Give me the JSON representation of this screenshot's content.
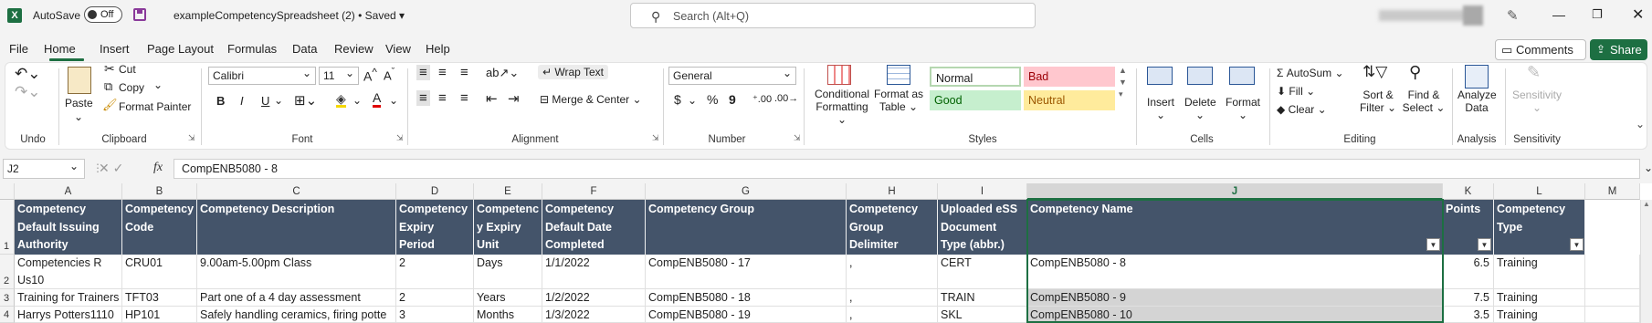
{
  "titlebar": {
    "app_logo": "X",
    "autosave_label": "AutoSave",
    "autosave_state": "Off",
    "doc_title": "exampleCompetencySpreadsheet (2) • Saved",
    "search_placeholder": "Search (Alt+Q)",
    "icons": [
      "excel-logo-icon",
      "save-icon",
      "search-icon",
      "pen-icon",
      "minimize-icon",
      "maximize-icon",
      "close-icon"
    ]
  },
  "menu": {
    "items": [
      "File",
      "Home",
      "Insert",
      "Page Layout",
      "Formulas",
      "Data",
      "Review",
      "View",
      "Help"
    ],
    "active": "Home",
    "comments": "Comments",
    "share": "Share"
  },
  "ribbon": {
    "undo": {
      "label": "Undo"
    },
    "clipboard": {
      "paste": "Paste",
      "cut": "Cut",
      "copy": "Copy",
      "format_painter": "Format Painter",
      "label": "Clipboard"
    },
    "font": {
      "name": "Calibri",
      "size": "11",
      "bold": "B",
      "italic": "I",
      "underline": "U",
      "label": "Font"
    },
    "alignment": {
      "wrap_text": "Wrap Text",
      "merge_center": "Merge & Center",
      "label": "Alignment"
    },
    "number": {
      "format": "General",
      "currency": "$",
      "percent": "%",
      "comma": "9",
      "label": "Number"
    },
    "styles": {
      "conditional_formatting": "Conditional Formatting",
      "format_as_table": "Format as Table",
      "normal": "Normal",
      "bad": "Bad",
      "good": "Good",
      "neutral": "Neutral",
      "label": "Styles"
    },
    "cells": {
      "insert": "Insert",
      "delete": "Delete",
      "format": "Format",
      "label": "Cells"
    },
    "editing": {
      "autosum": "AutoSum",
      "fill": "Fill",
      "clear": "Clear",
      "sort_filter": "Sort & Filter",
      "find_select": "Find & Select",
      "label": "Editing"
    },
    "analysis": {
      "analyze_data": "Analyze Data",
      "label": "Analysis"
    },
    "sensitivity": {
      "sensitivity": "Sensitivity",
      "label": "Sensitivity"
    }
  },
  "formula_bar": {
    "name_box": "J2",
    "fx": "fx",
    "formula": "CompENB5080 - 8"
  },
  "grid": {
    "columns": [
      "A",
      "B",
      "C",
      "D",
      "E",
      "F",
      "G",
      "H",
      "I",
      "J",
      "K",
      "L",
      "M"
    ],
    "selected_column": "J",
    "row_numbers": [
      "1",
      "2",
      "3",
      "4"
    ],
    "headers": [
      "Competency Default Issuing Authority",
      "Competency Code",
      "Competency Description",
      "Competency Expiry Period",
      "Competenc y Expiry Unit",
      "Competency Default Date Completed",
      "Competency Group",
      "Competency Group Delimiter",
      "Uploaded eSS Document Type (abbr.)",
      "Competency Name",
      "Points",
      "Competency Type"
    ],
    "rows": [
      [
        "Competencies R Us10",
        "CRU01",
        "9.00am-5.00pm Class",
        "2",
        "Days",
        "1/1/2022",
        "CompENB5080 - 17",
        ",",
        "CERT",
        "CompENB5080 - 8",
        "6.5",
        "Training"
      ],
      [
        "Training for Trainers",
        "TFT03",
        "Part one of a 4 day assessment",
        "2",
        "Years",
        "1/2/2022",
        "CompENB5080 - 18",
        ",",
        "TRAIN",
        "CompENB5080 - 9",
        "7.5",
        "Training"
      ],
      [
        "Harrys Potters1110",
        "HP101",
        "Safely handling ceramics, firing potte",
        "3",
        "Months",
        "1/3/2022",
        "CompENB5080 - 19",
        ",",
        "SKL",
        "CompENB5080 - 10",
        "3.5",
        "Training"
      ]
    ],
    "header_color": "#44546a",
    "accent_color": "#1d6f42"
  }
}
